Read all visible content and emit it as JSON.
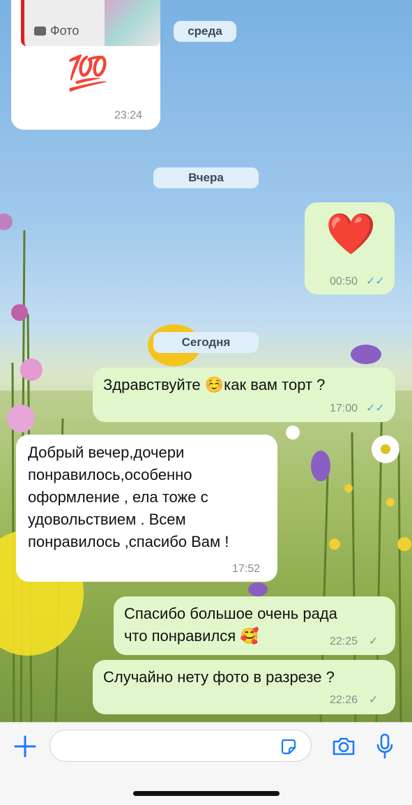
{
  "chat": {
    "reply_preview": {
      "media_label": "Фото",
      "emoji": "💯",
      "time": "23:24"
    },
    "date_pills": {
      "wednesday": "среда",
      "yesterday": "Вчера",
      "today": "Сегодня"
    },
    "messages": [
      {
        "dir": "out",
        "text": "❤️",
        "time": "00:50",
        "status": "read"
      },
      {
        "dir": "out",
        "text": "Здравствуйте ☺️как вам торт ?",
        "time": "17:00",
        "status": "read"
      },
      {
        "dir": "in",
        "lines": [
          "Добрый вечер,дочери",
          "понравилось,особенно",
          "оформление , ела тоже с",
          "удовольствием . Всем",
          "понравилось ,спасибо Вам !"
        ],
        "time": "17:52"
      },
      {
        "dir": "out",
        "lines": [
          "Спасибо большое очень рада",
          "что понравился 🥰"
        ],
        "time": "22:25",
        "status": "sent"
      },
      {
        "dir": "out",
        "text": "Случайно нету фото в разрезе ?",
        "time": "22:26",
        "status": "sent"
      }
    ]
  },
  "input": {
    "placeholder": "",
    "icons": [
      "plus-icon",
      "sticker-icon",
      "camera-icon",
      "microphone-icon"
    ]
  },
  "colors": {
    "incoming_bubble": "#ffffff",
    "outgoing_bubble": "#e1f7cb",
    "accent": "#1a7cf5",
    "read_ticks": "#4ba3f3"
  }
}
